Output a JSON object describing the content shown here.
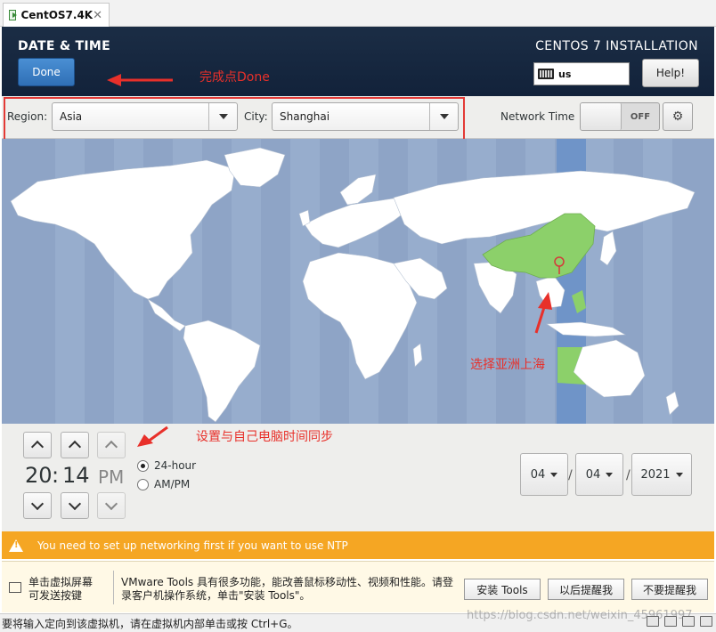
{
  "tab": {
    "title": "CentOS7.4K",
    "close": "✕"
  },
  "header": {
    "title": "DATE & TIME",
    "done_label": "Done",
    "install_title": "CENTOS 7 INSTALLATION",
    "keyboard_layout": "us",
    "help_label": "Help!"
  },
  "annotations": {
    "done_note": "完成点Done",
    "region_note": "选择亚洲上海",
    "time_note": "设置与自己电脑时间同步",
    "color": "#e8302a"
  },
  "region_bar": {
    "region_label": "Region:",
    "region_value": "Asia",
    "city_label": "City:",
    "city_value": "Shanghai",
    "network_time_label": "Network Time",
    "network_time_state": "OFF"
  },
  "time": {
    "hours": "20",
    "separator": ":",
    "minutes": "14",
    "ampm": "PM",
    "format_24": "24-hour",
    "format_ampm": "AM/PM",
    "selected_format": "24-hour"
  },
  "date": {
    "month": "04",
    "day": "04",
    "year": "2021",
    "separator": "/"
  },
  "warning": {
    "text": "You need to set up networking first if you want to use NTP"
  },
  "vmware_tools": {
    "left_text_line1": "单击虚拟屏幕",
    "left_text_line2": "可发送按键",
    "message": "VMware Tools 具有很多功能，能改善鼠标移动性、视频和性能。请登录客户机操作系统，单击\"安装 Tools\"。",
    "install_button": "安装 Tools",
    "remind_later_button": "以后提醒我",
    "never_remind_button": "不要提醒我"
  },
  "statusbar": {
    "text": "要将输入定向到该虚拟机，请在虚拟机内部单击或按 Ctrl+G。",
    "watermark": "https://blog.csdn.net/weixin_45961997"
  },
  "colors": {
    "header_bg": "#1b2d45",
    "map_water": "#8ea4c6",
    "map_land": "#ffffff",
    "selected_tz": "#7aa0d0",
    "selected_country": "#8cd06a",
    "warning": "#f5a623",
    "done_button": "#3b7fc6"
  }
}
